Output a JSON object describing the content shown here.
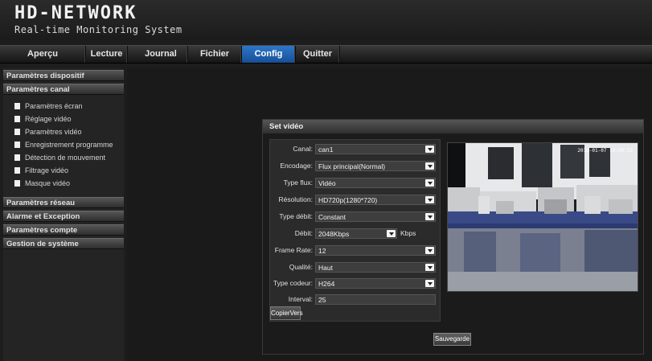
{
  "header": {
    "logo": "HD-NETWORK",
    "subtitle": "Real-time Monitoring System"
  },
  "nav": {
    "tabs": [
      "Aperçu",
      "Lecture",
      "Journal",
      "Fichier",
      "Config",
      "Quitter"
    ],
    "active": "Config"
  },
  "sidebar": {
    "sections": [
      "Paramètres dispositif",
      "Paramètres canal",
      "Paramètres réseau",
      "Alarme et Exception",
      "Paramètres compte",
      "Gestion de système"
    ],
    "items": [
      "Paramètres écran",
      "Réglage vidéo",
      "Paramètres vidéo",
      "Enregistrement programme",
      "Détection de mouvement",
      "Filtrage vidéo",
      "Masque vidéo"
    ]
  },
  "panel": {
    "title": "Set vidéo",
    "fields": {
      "canal": {
        "label": "Canal:",
        "value": "can1"
      },
      "encodage": {
        "label": "Encodage:",
        "value": "Flux principal(Normal)"
      },
      "type_flux": {
        "label": "Type flux:",
        "value": "Vidéo"
      },
      "resolution": {
        "label": "Résolution:",
        "value": "HD720p(1280*720)"
      },
      "type_debit": {
        "label": "Type débit:",
        "value": "Constant"
      },
      "debit": {
        "label": "Débit:",
        "value": "2048Kbps",
        "unit": "Kbps"
      },
      "frame_rate": {
        "label": "Frame Rate:",
        "value": "12"
      },
      "qualite": {
        "label": "Qualité:",
        "value": "Haut"
      },
      "type_codeur": {
        "label": "Type codeur:",
        "value": "H264"
      },
      "interval": {
        "label": "Interval:",
        "value": "25"
      }
    },
    "copy_button": "CopierVers",
    "save_button": "Sauvegarde",
    "preview_osd": "2018-01-07 13:50:33"
  },
  "colors": {
    "accent": "#2f76c9",
    "background": "#1d1d1d"
  }
}
